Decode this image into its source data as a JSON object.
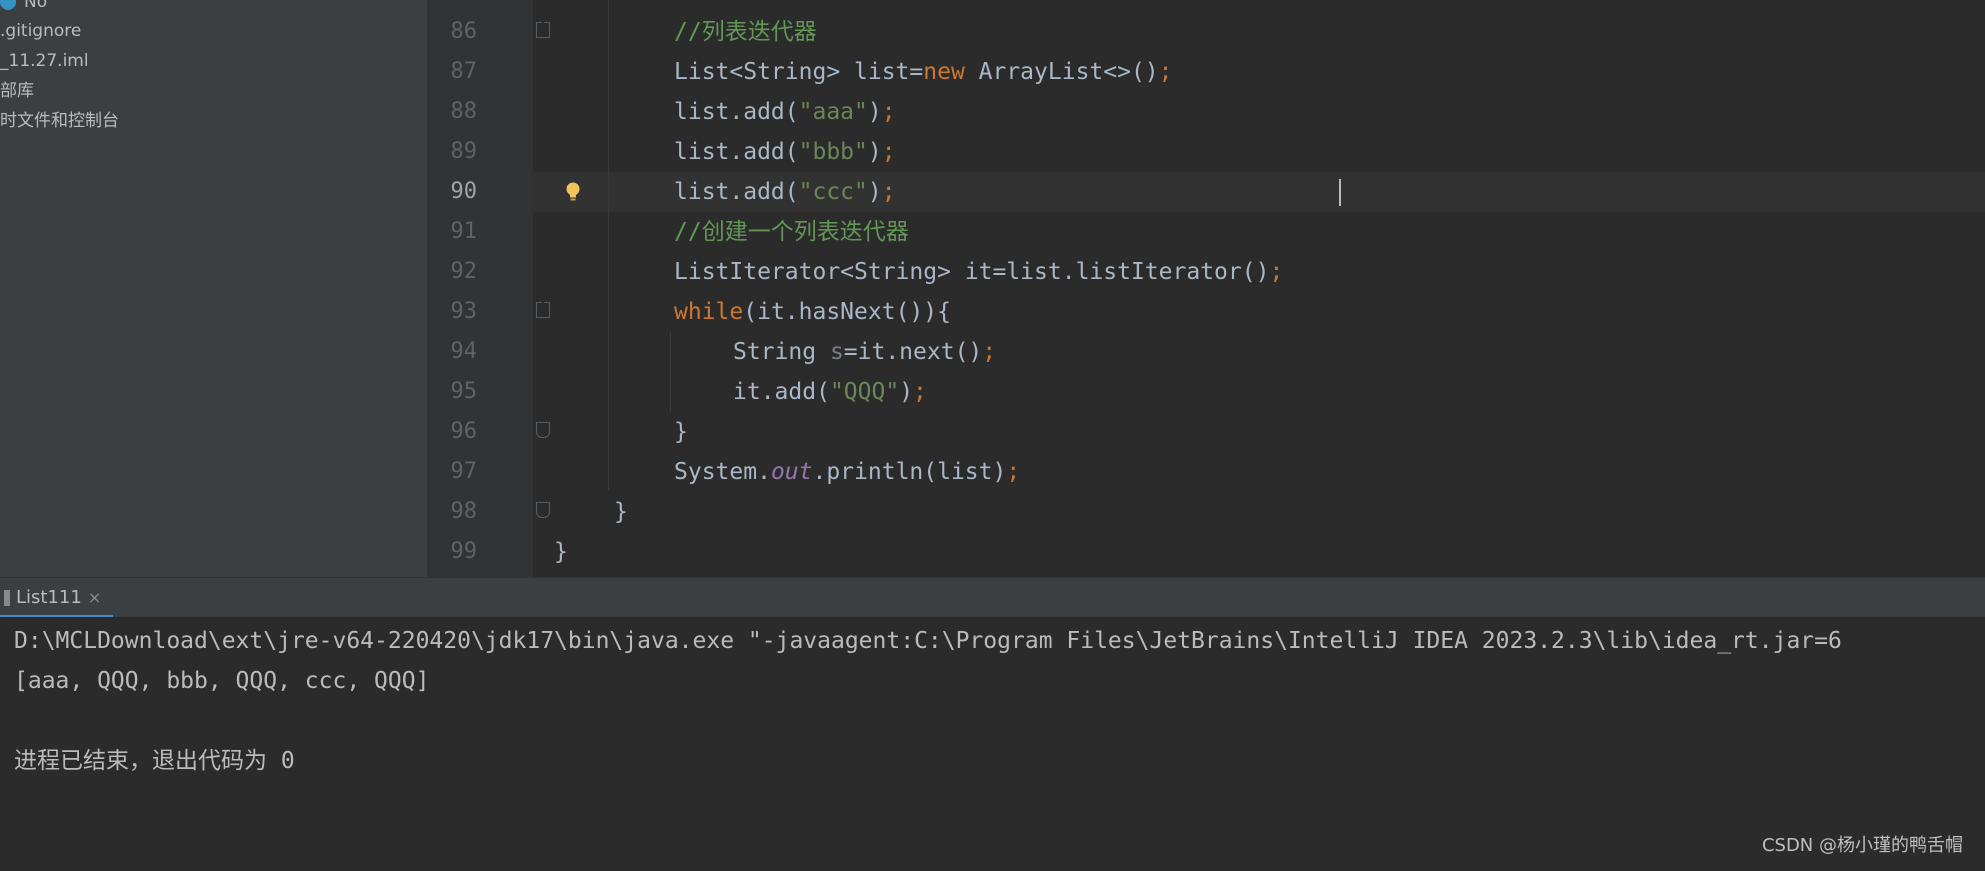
{
  "sidebar": {
    "items": [
      {
        "label": "No",
        "icon": "vcs-icon"
      },
      {
        "label": ".gitignore"
      },
      {
        "label": "_11.27.iml"
      },
      {
        "label": "部库"
      },
      {
        "label": "时文件和控制台"
      }
    ]
  },
  "editor": {
    "line_numbers": [
      "86",
      "87",
      "88",
      "89",
      "90",
      "91",
      "92",
      "93",
      "94",
      "95",
      "96",
      "97",
      "98",
      "99"
    ],
    "current_line": "90"
  },
  "run_panel": {
    "tab_label": "List111",
    "tab_close": "×",
    "console_lines": [
      "D:\\MCLDownload\\ext\\jre-v64-220420\\jdk17\\bin\\java.exe \"-javaagent:C:\\Program Files\\JetBrains\\IntelliJ IDEA 2023.2.3\\lib\\idea_rt.jar=6",
      "[aaa, QQQ, bbb, QQQ, ccc, QQQ]",
      "",
      "进程已结束，退出代码为 0"
    ]
  },
  "watermark": "CSDN @杨小瑾的鸭舌帽",
  "colors": {
    "keyword": "#cc7832",
    "string": "#6a8759",
    "comment": "#629755",
    "field": "#9876aa",
    "text": "#a9b7c6"
  }
}
